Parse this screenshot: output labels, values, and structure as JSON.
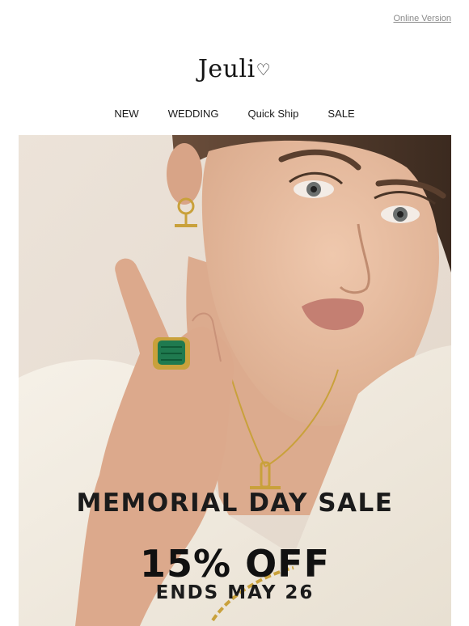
{
  "header": {
    "online_version": "Online Version",
    "logo_text": "Jeuli",
    "logo_heart": "♡"
  },
  "nav": {
    "items": [
      {
        "label": "NEW"
      },
      {
        "label": "WEDDING"
      },
      {
        "label": "Quick Ship"
      },
      {
        "label": "SALE"
      }
    ]
  },
  "hero": {
    "headline": "MEMORIAL DAY SALE",
    "discount": "15% OFF",
    "ends": "ENDS MAY 26",
    "colors": {
      "background": "#e9e0d6",
      "skin": "#e3b79b",
      "top": "#f2ece1",
      "gold": "#c9a13b",
      "malachite": "#1f7a4f",
      "hair": "#4a3527"
    }
  }
}
